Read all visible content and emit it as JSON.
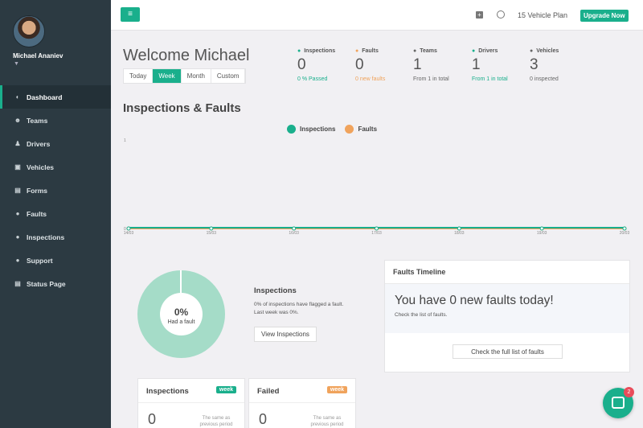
{
  "sidebar": {
    "user_name": "Michael Ananiev",
    "items": [
      {
        "label": "Dashboard",
        "icon": "dashboard-icon",
        "glyph": "◐"
      },
      {
        "label": "Teams",
        "icon": "users-icon",
        "glyph": "☻"
      },
      {
        "label": "Drivers",
        "icon": "driver-icon",
        "glyph": "♟"
      },
      {
        "label": "Vehicles",
        "icon": "bus-icon",
        "glyph": "▣"
      },
      {
        "label": "Forms",
        "icon": "form-icon",
        "glyph": "▤"
      },
      {
        "label": "Faults",
        "icon": "alert-icon",
        "glyph": "●"
      },
      {
        "label": "Inspections",
        "icon": "check-circle-icon",
        "glyph": "●"
      },
      {
        "label": "Support",
        "icon": "question-icon",
        "glyph": "●"
      },
      {
        "label": "Status Page",
        "icon": "list-icon",
        "glyph": "▤"
      }
    ]
  },
  "topbar": {
    "plan": "15 Vehicle Plan",
    "upgrade": "Upgrade Now"
  },
  "welcome": "Welcome Michael",
  "ranges": [
    "Today",
    "Week",
    "Month",
    "Custom"
  ],
  "stats": [
    {
      "label": "Inspections",
      "value": "0",
      "sub": "0 % Passed",
      "icon": "check-icon",
      "color": "#1aaf8c"
    },
    {
      "label": "Faults",
      "value": "0",
      "sub": "0 new faults",
      "icon": "alert-icon",
      "color": "#f0a35c"
    },
    {
      "label": "Teams",
      "value": "1",
      "sub": "From 1 in total",
      "icon": "users-icon",
      "color": "#666"
    },
    {
      "label": "Drivers",
      "value": "1",
      "sub": "From 1 in total",
      "icon": "driver-icon",
      "color": "#1aaf8c"
    },
    {
      "label": "Vehicles",
      "value": "3",
      "sub": "0 inspected",
      "icon": "bus-icon",
      "color": "#666"
    }
  ],
  "section_title": "Inspections & Faults",
  "chart_data": {
    "type": "line",
    "x": [
      "14/03",
      "15/03",
      "16/03",
      "17/03",
      "18/03",
      "19/03",
      "20/03"
    ],
    "series": [
      {
        "name": "Inspections",
        "color": "#1aaf8c",
        "values": [
          0,
          0,
          0,
          0,
          0,
          0,
          0
        ]
      },
      {
        "name": "Faults",
        "color": "#f0a35c",
        "values": [
          0,
          0,
          0,
          0,
          0,
          0,
          0
        ]
      }
    ],
    "ylim": [
      0,
      1
    ],
    "yticks": [
      "0",
      "1"
    ]
  },
  "donut": {
    "percent": "0%",
    "label": "Had a fault",
    "color": "#a5dcc8"
  },
  "inspections_panel": {
    "title": "Inspections",
    "text": "0% of inspections have flagged a fault. Last week was 0%.",
    "button": "View Inspections"
  },
  "timeline": {
    "title": "Faults Timeline",
    "headline": "You have 0 new faults today!",
    "sub": "Check the list of faults.",
    "button": "Check the full list of faults"
  },
  "cards": [
    {
      "title": "Inspections",
      "badge": "week",
      "badge_color": "#1aaf8c",
      "value": "0",
      "note": "The same as previous period"
    },
    {
      "title": "Failed",
      "badge": "week",
      "badge_color": "#f0a35c",
      "value": "0",
      "note": "The same as previous period"
    }
  ],
  "chat": {
    "badge": "2"
  }
}
